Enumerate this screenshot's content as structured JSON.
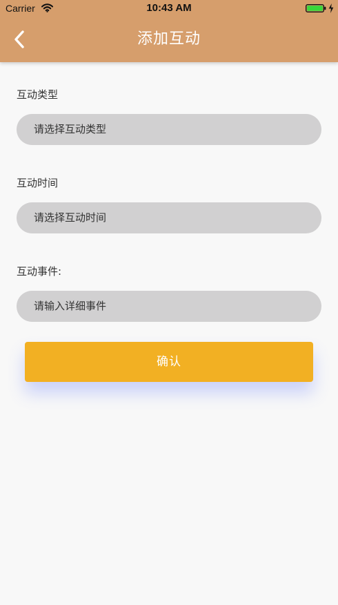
{
  "status_bar": {
    "carrier": "Carrier",
    "time": "10:43 AM",
    "wifi_icon": "wifi-icon",
    "battery_icon": "battery-icon",
    "charging_icon": "charging-bolt-icon"
  },
  "header": {
    "title": "添加互动",
    "back_icon": "chevron-left-icon",
    "background_color": "#d69e6c"
  },
  "form": {
    "type_label": "互动类型",
    "type_placeholder": "请选择互动类型",
    "time_label": "互动时间",
    "time_placeholder": "请选择互动时间",
    "event_label": "互动事件:",
    "event_placeholder": "请输入详细事件",
    "input_background_color": "#d1d0d1"
  },
  "actions": {
    "confirm_label": "确认",
    "confirm_color": "#f2b023"
  }
}
